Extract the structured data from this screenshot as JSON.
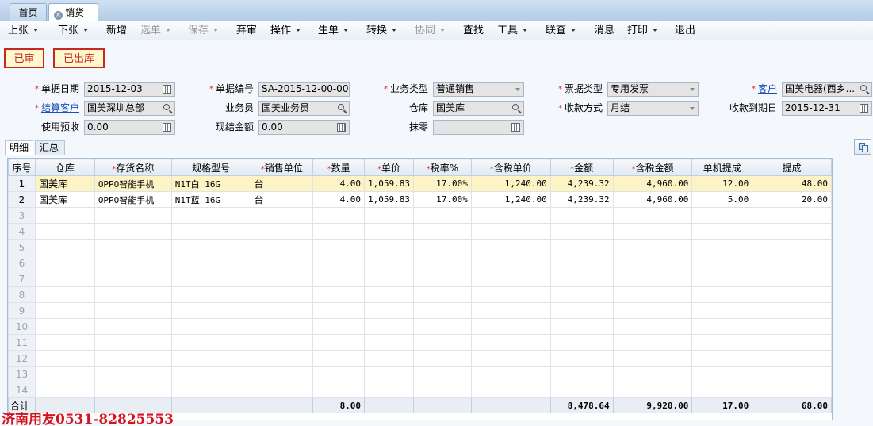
{
  "tabs": {
    "home": "首页",
    "active": "销货单"
  },
  "toolbar": {
    "prev": "上张",
    "next": "下张",
    "new": "新增",
    "select": "选单",
    "save": "保存",
    "abandon": "弃审",
    "operate": "操作",
    "generate": "生单",
    "convert": "转换",
    "collab": "协同",
    "find": "查找",
    "tools": "工具",
    "linked": "联查",
    "message": "消息",
    "print": "打印",
    "exit": "退出"
  },
  "status": {
    "audited": "已审",
    "outbound": "已出库"
  },
  "form": {
    "doc_date_label": "单据日期",
    "doc_date": "2015-12-03",
    "doc_no_label": "单据编号",
    "doc_no": "SA-2015-12-00-00...",
    "biz_type_label": "业务类型",
    "biz_type": "普通销售",
    "invoice_type_label": "票据类型",
    "invoice_type": "专用发票",
    "customer_label": "客户",
    "customer": "国美电器(西乡...",
    "settle_customer_label": "结算客户",
    "settle_customer": "国美深圳总部",
    "salesman_label": "业务员",
    "salesman": "国美业务员",
    "warehouse_label": "仓库",
    "warehouse": "国美库",
    "payment_label": "收款方式",
    "payment": "月结",
    "due_date_label": "收款到期日",
    "due_date": "2015-12-31",
    "prepay_label": "使用预收",
    "prepay": "0.00",
    "cash_label": "现结金额",
    "cash": "0.00",
    "rounding_label": "抹零",
    "rounding": ""
  },
  "subtabs": {
    "detail": "明细",
    "summary": "汇总"
  },
  "table": {
    "headers": {
      "seq": "序号",
      "warehouse": "仓库",
      "item": "存货名称",
      "spec": "规格型号",
      "unit": "销售单位",
      "qty": "数量",
      "price": "单价",
      "tax": "税率%",
      "taxprice": "含税单价",
      "amount": "金额",
      "taxamount": "含税金额",
      "commission_unit": "单机提成",
      "commission": "提成"
    },
    "rows": [
      {
        "seq": "1",
        "warehouse": "国美库",
        "item": "OPPO智能手机",
        "spec": "N1T白 16G",
        "unit": "台",
        "qty": "4.00",
        "price": "1,059.83",
        "tax": "17.00%",
        "taxprice": "1,240.00",
        "amount": "4,239.32",
        "taxamount": "4,960.00",
        "commission_unit": "12.00",
        "commission": "48.00"
      },
      {
        "seq": "2",
        "warehouse": "国美库",
        "item": "OPPO智能手机",
        "spec": "N1T蓝 16G",
        "unit": "台",
        "qty": "4.00",
        "price": "1,059.83",
        "tax": "17.00%",
        "taxprice": "1,240.00",
        "amount": "4,239.32",
        "taxamount": "4,960.00",
        "commission_unit": "5.00",
        "commission": "20.00"
      }
    ],
    "empty_rows": [
      "3",
      "4",
      "5",
      "6",
      "7",
      "8",
      "9",
      "10",
      "11",
      "12",
      "13",
      "14"
    ],
    "total": {
      "label": "合计",
      "qty": "8.00",
      "amount": "8,478.64",
      "taxamount": "9,920.00",
      "commission_unit": "17.00",
      "commission": "68.00"
    }
  },
  "watermark": "济南用友0531-82825553"
}
